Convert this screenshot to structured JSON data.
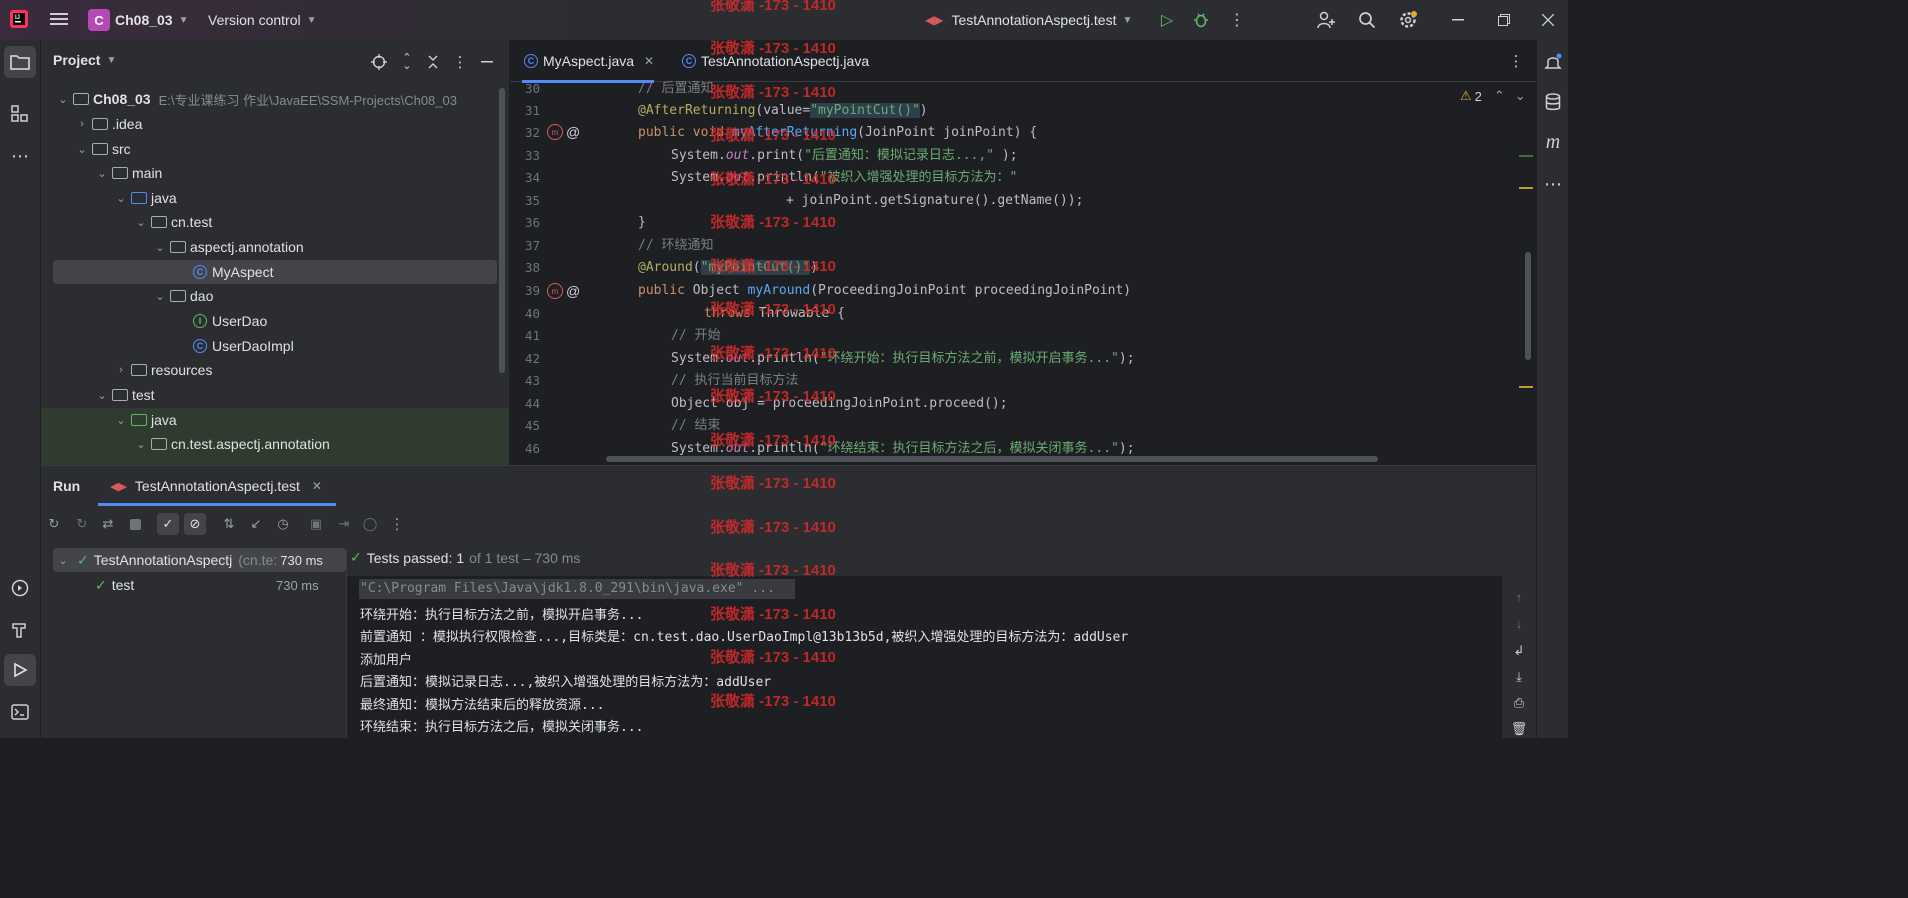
{
  "titlebar": {
    "project_badge": "C",
    "project_name": "Ch08_03",
    "version_control": "Version control",
    "run_config": "TestAnnotationAspectj.test"
  },
  "project_panel": {
    "title": "Project",
    "root_name": "Ch08_03",
    "root_path": "E:\\专业课练习 作业\\JavaEE\\SSM-Projects\\Ch08_03",
    "tree": [
      {
        "label": ".idea"
      },
      {
        "label": "src"
      },
      {
        "label": "main"
      },
      {
        "label": "java"
      },
      {
        "label": "cn.test"
      },
      {
        "label": "aspectj.annotation"
      },
      {
        "label": "MyAspect"
      },
      {
        "label": "dao"
      },
      {
        "label": "UserDao"
      },
      {
        "label": "UserDaoImpl"
      },
      {
        "label": "resources"
      },
      {
        "label": "test"
      },
      {
        "label": "java"
      },
      {
        "label": "cn.test.aspectj.annotation"
      }
    ]
  },
  "editor": {
    "tabs": [
      {
        "label": "MyAspect.java"
      },
      {
        "label": "TestAnnotationAspectj.java"
      }
    ],
    "warnings_count": "2",
    "line_numbers": [
      "30",
      "31",
      "32",
      "33",
      "34",
      "35",
      "36",
      "37",
      "38",
      "39",
      "40",
      "41",
      "42",
      "43",
      "44",
      "45",
      "46"
    ],
    "code": {
      "l30": "// 后置通知",
      "l31_a": "@AfterReturning",
      "l31_b": "(value=",
      "l31_c": "\"myPointCut()\"",
      "l31_d": ")",
      "l32_a": "public void ",
      "l32_b": "myAfterReturning",
      "l32_c": "(JoinPoint joinPoint) {",
      "l33_a": "System.",
      "l33_b": "out",
      "l33_c": ".print(",
      "l33_d": "\"后置通知：模拟记录日志...,\"",
      "l33_e": " );",
      "l34_a": "System.",
      "l34_b": "out",
      "l34_c": ".println(",
      "l34_d": "\"被织入增强处理的目标方法为：\"",
      "l35": "+ joinPoint.getSignature().getName());",
      "l36": "}",
      "l37": "// 环绕通知",
      "l38_a": "@Around",
      "l38_b": "(",
      "l38_c": "\"myPointCut()\"",
      "l38_d": ")",
      "l39_a": "public ",
      "l39_b": "Object ",
      "l39_c": "myAround",
      "l39_d": "(ProceedingJoinPoint proceedingJoinPoint)",
      "l40_a": "throws ",
      "l40_b": "Throwable {",
      "l41": "// 开始",
      "l42_a": "System.",
      "l42_b": "out",
      "l42_c": ".println(",
      "l42_d": "\"环绕开始：执行目标方法之前，模拟开启事务...\"",
      "l42_e": ");",
      "l43": "// 执行当前目标方法",
      "l44": "Object obj = proceedingJoinPoint.proceed();",
      "l45": "// 结束",
      "l46_a": "System.",
      "l46_b": "out",
      "l46_c": ".println(",
      "l46_d": "\"环绕结束：执行目标方法之后，模拟关闭事务...\"",
      "l46_e": ");"
    }
  },
  "run_panel": {
    "title": "Run",
    "tab_label": "TestAnnotationAspectj.test",
    "tests": [
      {
        "name": "TestAnnotationAspectj",
        "suffix": "(cn.te:",
        "time": "730 ms"
      },
      {
        "name": "test",
        "time": "730 ms"
      }
    ],
    "status_label": "Tests passed:",
    "status_count": "1",
    "status_detail": "of 1 test – 730 ms",
    "console": [
      "\"C:\\Program Files\\Java\\jdk1.8.0_291\\bin\\java.exe\" ...",
      "环绕开始：执行目标方法之前，模拟开启事务...",
      "前置通知 ：模拟执行权限检查...,目标类是：cn.test.dao.UserDaoImpl@13b13b5d,被织入增强处理的目标方法为：addUser",
      "添加用户",
      "后置通知：模拟记录日志...,被织入增强处理的目标方法为：addUser",
      "最终通知：模拟方法结束后的释放资源...",
      "环绕结束：执行目标方法之后，模拟关闭事务..."
    ]
  },
  "watermark": "张敬潇 -173 - 1410",
  "colors": {
    "accent": "#548af7",
    "success": "#5fb865",
    "watermark": "#d92a2a"
  }
}
